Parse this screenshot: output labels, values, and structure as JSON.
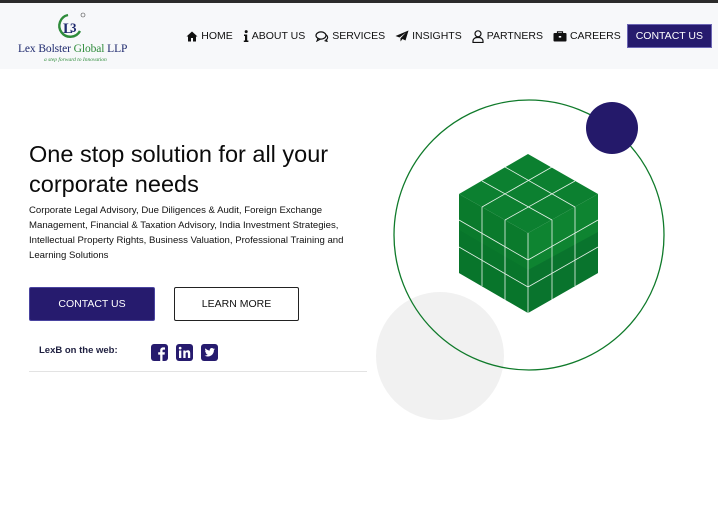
{
  "brand": {
    "name_prefix": "Lex Bolster",
    "name_highlight": "Global",
    "name_suffix": "LLP",
    "tagline": "a step forward to Innovation",
    "colors": {
      "primary": "#261b6e",
      "green": "#2e8b3a"
    }
  },
  "nav": {
    "items": [
      {
        "label": "HOME",
        "icon": "home-icon"
      },
      {
        "label": "ABOUT US",
        "icon": "info-icon"
      },
      {
        "label": "SERVICES",
        "icon": "chat-icon"
      },
      {
        "label": "INSIGHTS",
        "icon": "paper-plane-icon"
      },
      {
        "label": "PARTNERS",
        "icon": "user-icon"
      },
      {
        "label": "CAREERS",
        "icon": "briefcase-icon"
      }
    ],
    "contact_label": "CONTACT US"
  },
  "hero": {
    "title": "One stop solution for all your corporate needs",
    "description": "Corporate Legal Advisory, Due Diligences & Audit, Foreign Exchange Management, Financial & Taxation Advisory, India Investment Strategies, Intellectual Property Rights, Business Valuation, Professional Training and Learning Solutions",
    "primary_button": "CONTACT US",
    "secondary_button": "LEARN MORE"
  },
  "social": {
    "label": "LexB on the web:",
    "icons": [
      "facebook-icon",
      "linkedin-icon",
      "twitter-icon"
    ]
  }
}
